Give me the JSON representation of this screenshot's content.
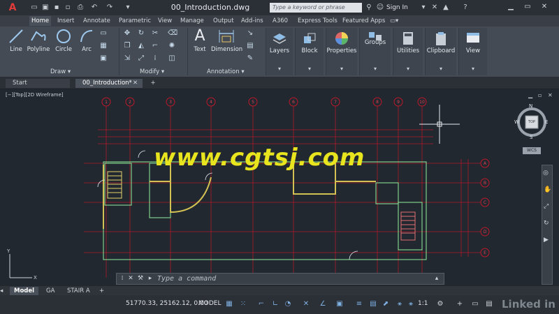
{
  "app": {
    "logo_text": "A",
    "document_title": "00_Introduction.dwg"
  },
  "quick_access": [
    "new-icon",
    "open-icon",
    "save-icon",
    "saveas-icon",
    "print-icon",
    "undo-icon",
    "redo-icon",
    "share-icon"
  ],
  "search": {
    "placeholder": "Type a keyword or phrase"
  },
  "signin": {
    "label": "Sign In"
  },
  "menu_tabs": [
    "Home",
    "Insert",
    "Annotate",
    "Parametric",
    "View",
    "Manage",
    "Output",
    "Add-ins",
    "A360",
    "Express Tools",
    "Featured Apps"
  ],
  "ribbon": {
    "draw": {
      "label": "Draw",
      "tools": [
        "Line",
        "Polyline",
        "Circle",
        "Arc"
      ]
    },
    "modify": {
      "label": "Modify"
    },
    "annotation": {
      "label": "Annotation",
      "tools": [
        "Text",
        "Dimension"
      ]
    },
    "panels": [
      "Layers",
      "Block",
      "Properties",
      "Groups",
      "Utilities",
      "Clipboard",
      "View"
    ]
  },
  "doc_tabs": [
    {
      "label": "Start"
    },
    {
      "label": "00_Introduction*"
    }
  ],
  "viewport": {
    "label": "[−][Top][2D Wireframe]",
    "watermark": "www.cgtsj.com",
    "grid_top_labels": [
      "1",
      "2",
      "3",
      "4",
      "5",
      "6",
      "7",
      "8",
      "9",
      "10"
    ],
    "grid_right_labels": [
      "A",
      "B",
      "C",
      "D",
      "E"
    ],
    "viewcube": {
      "top": "TOP",
      "n": "N",
      "s": "S",
      "e": "E",
      "w": "W",
      "wcs": "WCS"
    }
  },
  "command": {
    "placeholder": "Type a command"
  },
  "layout_tabs": [
    "Model",
    "GA",
    "STAIR A"
  ],
  "status": {
    "coords": "51770.33, 25162.12, 0.00",
    "space": "MODEL",
    "scale": "1:1",
    "brand": "Linked in"
  },
  "colors": {
    "accent": "#e23b3b",
    "grid": "#c0182a",
    "watermark": "#e8e51e"
  }
}
